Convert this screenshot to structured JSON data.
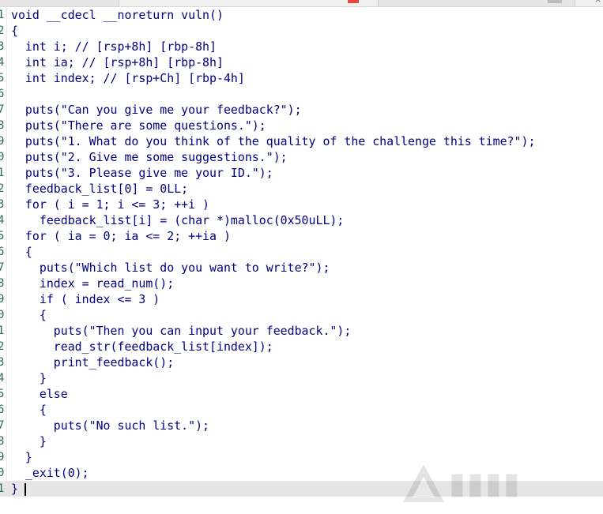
{
  "lines": [
    {
      "num": "1",
      "text": "void __cdecl __noreturn vuln()"
    },
    {
      "num": "2",
      "text": "{"
    },
    {
      "num": "3",
      "text": "  int i; // [rsp+8h] [rbp-8h]"
    },
    {
      "num": "4",
      "text": "  int ia; // [rsp+8h] [rbp-8h]"
    },
    {
      "num": "5",
      "text": "  int index; // [rsp+Ch] [rbp-4h]"
    },
    {
      "num": "6",
      "text": ""
    },
    {
      "num": "7",
      "text": "  puts(\"Can you give me your feedback?\");"
    },
    {
      "num": "8",
      "text": "  puts(\"There are some questions.\");"
    },
    {
      "num": "9",
      "text": "  puts(\"1. What do you think of the quality of the challenge this time?\");"
    },
    {
      "num": "0",
      "text": "  puts(\"2. Give me some suggestions.\");"
    },
    {
      "num": "1",
      "text": "  puts(\"3. Please give me your ID.\");"
    },
    {
      "num": "2",
      "text": "  feedback_list[0] = 0LL;"
    },
    {
      "num": "3",
      "text": "  for ( i = 1; i <= 3; ++i )"
    },
    {
      "num": "4",
      "text": "    feedback_list[i] = (char *)malloc(0x50uLL);"
    },
    {
      "num": "5",
      "text": "  for ( ia = 0; ia <= 2; ++ia )"
    },
    {
      "num": "6",
      "text": "  {"
    },
    {
      "num": "7",
      "text": "    puts(\"Which list do you want to write?\");"
    },
    {
      "num": "8",
      "text": "    index = read_num();"
    },
    {
      "num": "9",
      "text": "    if ( index <= 3 )"
    },
    {
      "num": "0",
      "text": "    {"
    },
    {
      "num": "1",
      "text": "      puts(\"Then you can input your feedback.\");"
    },
    {
      "num": "2",
      "text": "      read_str(feedback_list[index]);"
    },
    {
      "num": "3",
      "text": "      print_feedback();"
    },
    {
      "num": "4",
      "text": "    }"
    },
    {
      "num": "5",
      "text": "    else"
    },
    {
      "num": "6",
      "text": "    {"
    },
    {
      "num": "7",
      "text": "      puts(\"No such list.\");"
    },
    {
      "num": "8",
      "text": "    }"
    },
    {
      "num": "9",
      "text": "  }"
    },
    {
      "num": "0",
      "text": "  _exit(0);"
    },
    {
      "num": "1",
      "text": "}"
    }
  ],
  "colors": {
    "code_text": "#000080",
    "line_number": "#2a6a5e",
    "current_line_bg": "#e6e6e6",
    "tab_accent": "#e24a3b"
  },
  "icons": {
    "tab_close": "close-icon"
  }
}
